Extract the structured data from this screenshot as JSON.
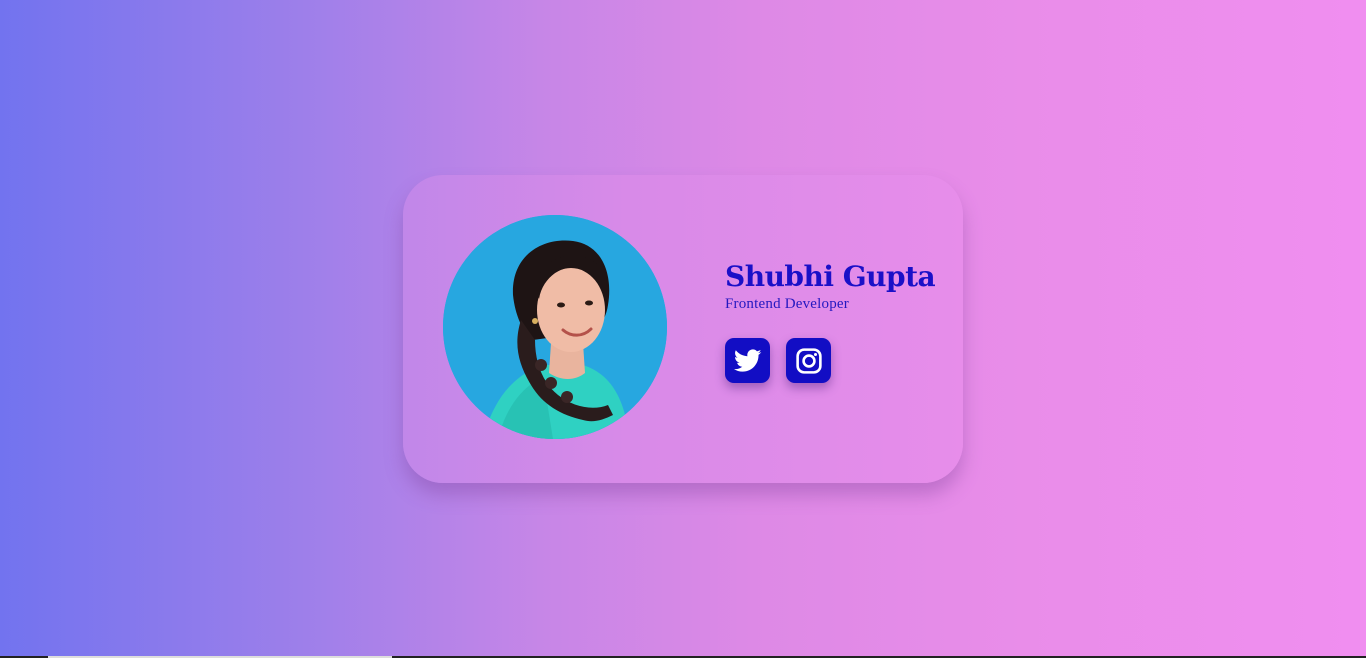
{
  "profile": {
    "name": "Shubhi Gupta",
    "role": "Frontend Developer",
    "avatar": "profile-photo"
  },
  "socials": [
    {
      "icon": "twitter-icon"
    },
    {
      "icon": "instagram-icon"
    }
  ],
  "colors": {
    "accent": "#120dc4",
    "avatar_bg": "#27a7e0"
  }
}
